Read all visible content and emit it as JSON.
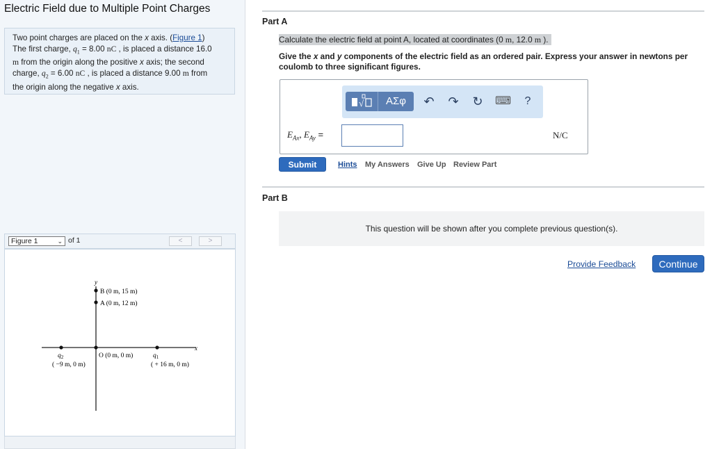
{
  "left": {
    "title": "Electric Field due to Multiple Point Charges",
    "problem": {
      "intro": "Two point charges are placed on the ",
      "axis_x": "x",
      "axis_after": " axis. (",
      "figure_link": "Figure 1",
      "intro_close": ")",
      "first_charge_pre": "The first charge, ",
      "q1_sym": "q",
      "q1_sub": "1",
      "q1_eq": " = 8.00 ",
      "q1_unit": "nC",
      "placed_16": " , is placed a distance 16.0",
      "unit_m1": "m",
      "from_origin_pos": " from the origin along the positive ",
      "axis_x2": "x",
      "axis_second": " axis; the second",
      "charge_word": "charge, ",
      "q2_sym": "q",
      "q2_sub": "2",
      "q2_eq": " = 6.00 ",
      "q2_unit": "nC",
      "placed_9": " , is placed a distance 9.00 ",
      "unit_m2": "m",
      "from": " from",
      "neg_axis": "the origin along the negative ",
      "axis_x3": "x",
      "axis_end": " axis."
    },
    "figure_nav": {
      "selected": "Figure 1",
      "of_label": "of 1",
      "prev": "<",
      "next": ">"
    },
    "figure": {
      "y_axis_label": "y",
      "x_axis_label": "x",
      "point_b": "B (0 m, 15 m)",
      "point_a": "A (0 m, 12 m)",
      "origin": "O (0 m, 0 m)",
      "q1_label": "q",
      "q1_sub": "1",
      "q1_coords": "( + 16 m, 0 m)",
      "q2_label": "q",
      "q2_sub": "2",
      "q2_coords": "( −9 m, 0 m)"
    }
  },
  "part_a": {
    "label": "Part A",
    "question_pre": "Calculate the electric field at point A, located at coordinates (0 ",
    "question_m1": "m",
    "question_mid": ", 12.0 ",
    "question_m2": "m",
    "question_end": " ).",
    "instr_pre": "Give the ",
    "instr_x": "x",
    "instr_and": " and ",
    "instr_y": "y",
    "instr_rest": " components of the electric field as an ordered pair. Express your answer in newtons per coulomb to three significant figures.",
    "toolbar": {
      "templates_icon": "templates-icon",
      "greek_label": "ΑΣφ",
      "undo_icon": "↶",
      "redo_icon": "↷",
      "reset_icon": "↻",
      "keyboard_icon": "⌨",
      "help_label": "?"
    },
    "eq_label": {
      "e": "E",
      "sub_ax": "Ax",
      "comma": ", ",
      "e2": "E",
      "sub_ay": "Ay",
      "equals": " ="
    },
    "input_value": "",
    "unit": "N/C",
    "submit": "Submit",
    "links": {
      "hints": "Hints",
      "my_answers": "My Answers",
      "give_up": "Give Up",
      "review_part": "Review Part"
    }
  },
  "part_b": {
    "label": "Part B",
    "locked_message": "This question will be shown after you complete previous question(s)."
  },
  "footer": {
    "provide_feedback": "Provide Feedback",
    "continue": "Continue"
  },
  "colors": {
    "accent": "#2e6bbd",
    "link": "#1a4b96",
    "toolbar_bg": "#d4e5f6",
    "toolbar_group": "#5b7fb3",
    "left_bg": "#f2f6fa"
  }
}
